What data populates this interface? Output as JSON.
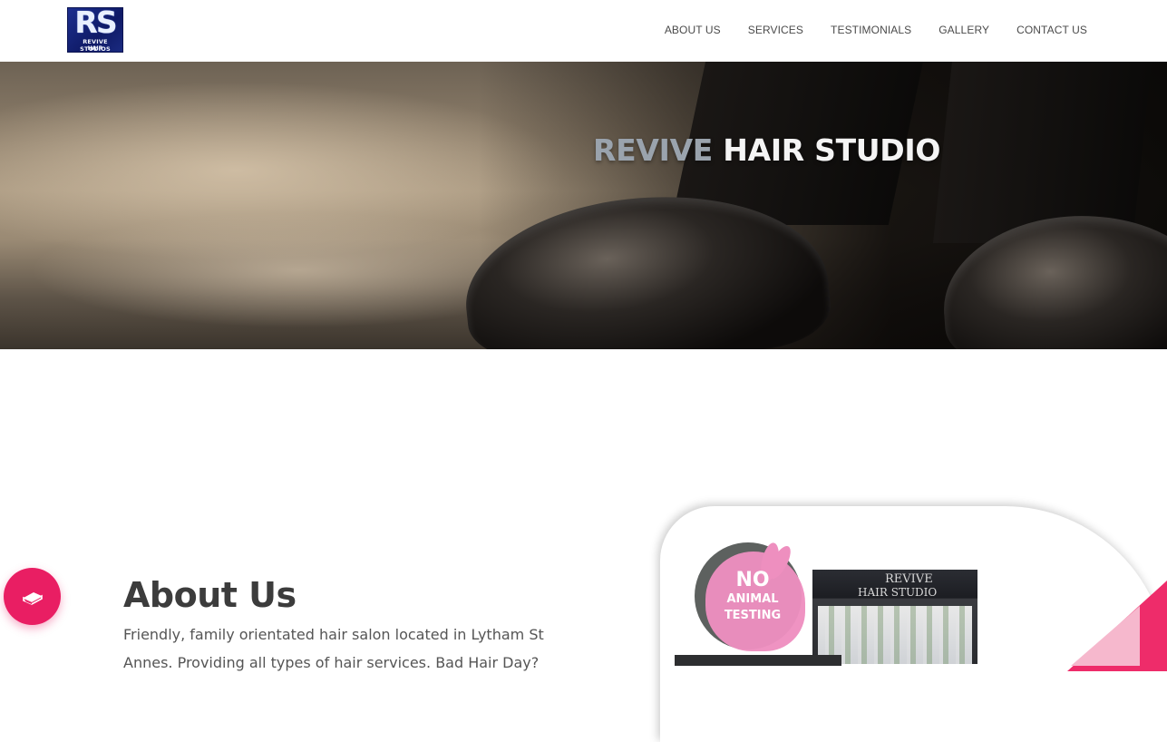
{
  "header": {
    "logo": {
      "mark": "RS",
      "line1": "REVIVE STUDIOS",
      "line2": "HAIR"
    },
    "nav": [
      {
        "label": "ABOUT US"
      },
      {
        "label": "SERVICES"
      },
      {
        "label": "TESTIMONIALS"
      },
      {
        "label": "GALLERY"
      },
      {
        "label": "CONTACT US"
      }
    ]
  },
  "hero": {
    "title_accent": "REVIVE",
    "title_rest": "HAIR STUDIO"
  },
  "about": {
    "title": "About Us",
    "text": "Friendly, family orientated hair salon located in Lytham St Annes. Providing all types of hair services. Bad Hair Day?",
    "fab_icon": "book-icon",
    "badge": {
      "line1": "NO",
      "line2": "ANIMAL",
      "line3": "TESTING"
    },
    "shop_sign": {
      "line1": "REVIVE",
      "line2": "HAIR STUDIO"
    }
  },
  "colors": {
    "accent": "#e91e63",
    "hero_accent": "#9aa3ad",
    "heading": "#3c3c3c",
    "nav_text": "#4a4a4a"
  }
}
